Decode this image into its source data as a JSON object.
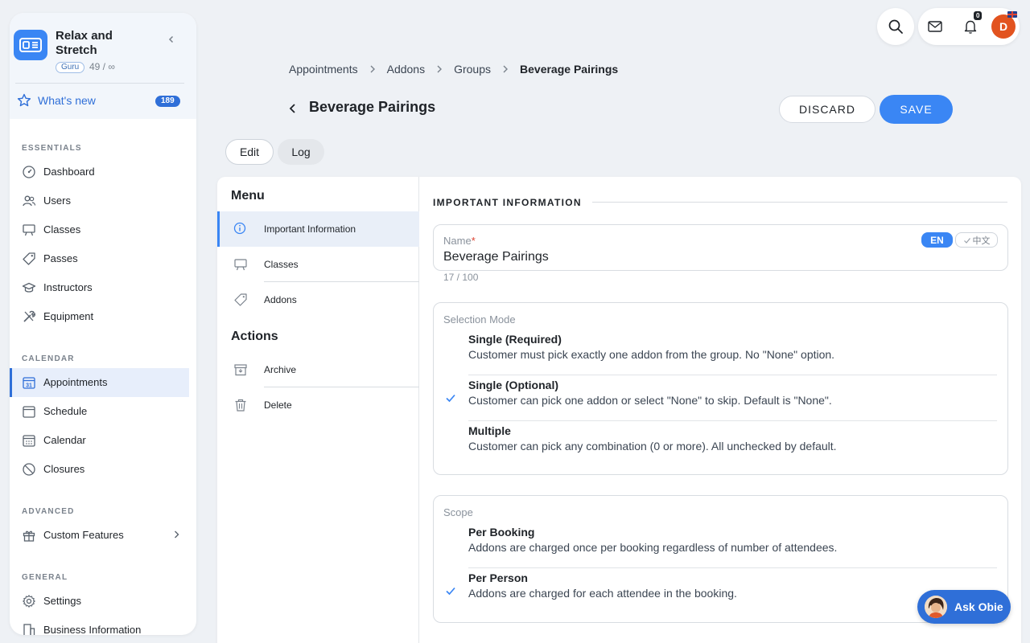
{
  "sidebar": {
    "app_name": "Relax and Stretch",
    "plan_badge": "Guru",
    "seat_count": "49 / ∞",
    "whats_new": {
      "label": "What's new",
      "count": "189"
    },
    "sections": [
      {
        "title": "ESSENTIALS",
        "items": [
          {
            "label": "Dashboard",
            "icon": "dashboard-gauge-icon"
          },
          {
            "label": "Users",
            "icon": "users-icon"
          },
          {
            "label": "Classes",
            "icon": "easel-icon"
          },
          {
            "label": "Passes",
            "icon": "tag-icon"
          },
          {
            "label": "Instructors",
            "icon": "graduation-cap-icon"
          },
          {
            "label": "Equipment",
            "icon": "tools-icon"
          }
        ]
      },
      {
        "title": "CALENDAR",
        "items": [
          {
            "label": "Appointments",
            "icon": "calendar-31-icon",
            "active": true
          },
          {
            "label": "Schedule",
            "icon": "schedule-icon"
          },
          {
            "label": "Calendar",
            "icon": "calendar-grid-icon"
          },
          {
            "label": "Closures",
            "icon": "prohibited-icon"
          }
        ]
      },
      {
        "title": "ADVANCED",
        "items": [
          {
            "label": "Custom Features",
            "icon": "gift-icon"
          }
        ]
      },
      {
        "title": "GENERAL",
        "items": [
          {
            "label": "Settings",
            "icon": "gear-icon"
          },
          {
            "label": "Business Information",
            "icon": "building-icon"
          }
        ]
      }
    ]
  },
  "topbar": {
    "notification_count": "0",
    "avatar_initial": "D"
  },
  "breadcrumb": [
    "Appointments",
    "Addons",
    "Groups",
    "Beverage Pairings"
  ],
  "page": {
    "title": "Beverage Pairings",
    "discard_label": "DISCARD",
    "save_label": "SAVE",
    "tabs": [
      "Edit",
      "Log"
    ]
  },
  "menu": {
    "menu_heading": "Menu",
    "menu_items": [
      {
        "label": "Important Information",
        "icon": "info-circle-icon",
        "active": true
      },
      {
        "label": "Classes",
        "icon": "easel-icon"
      },
      {
        "label": "Addons",
        "icon": "tag-icon"
      }
    ],
    "actions_heading": "Actions",
    "action_items": [
      {
        "label": "Archive",
        "icon": "archive-icon"
      },
      {
        "label": "Delete",
        "icon": "trash-icon"
      }
    ]
  },
  "form": {
    "section_title": "IMPORTANT INFORMATION",
    "name_field": {
      "label": "Name",
      "required_mark": "*",
      "value": "Beverage Pairings",
      "char_count": "17 / 100",
      "lang_active": "EN",
      "lang_other": "中文"
    },
    "selection_mode": {
      "label": "Selection Mode",
      "options": [
        {
          "title": "Single (Required)",
          "desc": "Customer must pick exactly one addon from the group. No \"None\" option.",
          "selected": false
        },
        {
          "title": "Single (Optional)",
          "desc": "Customer can pick one addon or select \"None\" to skip. Default is \"None\".",
          "selected": true
        },
        {
          "title": "Multiple",
          "desc": "Customer can pick any combination (0 or more). All unchecked by default.",
          "selected": false
        }
      ]
    },
    "scope": {
      "label": "Scope",
      "options": [
        {
          "title": "Per Booking",
          "desc": "Addons are charged once per booking regardless of number of attendees.",
          "selected": false
        },
        {
          "title": "Per Person",
          "desc": "Addons are charged for each attendee in the booking.",
          "selected": true
        }
      ]
    }
  },
  "assistant": {
    "label": "Ask Obie"
  },
  "colors": {
    "accent": "#3a86f4",
    "link": "#2f6fd8",
    "avatar": "#e2531f"
  }
}
